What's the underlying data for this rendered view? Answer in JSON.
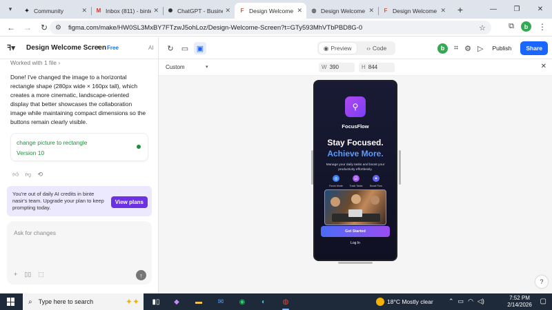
{
  "browser": {
    "tabs": [
      {
        "title": "Community",
        "icon": "community-icon",
        "active": false
      },
      {
        "title": "Inbox (811) - binte",
        "icon": "gmail-icon",
        "active": false
      },
      {
        "title": "ChatGPT - Business",
        "icon": "chatgpt-icon",
        "active": false
      },
      {
        "title": "Design Welcome S",
        "icon": "figma-icon",
        "active": true
      },
      {
        "title": "Design Welcome S",
        "icon": "globe-icon",
        "active": false
      },
      {
        "title": "Design Welcome S",
        "icon": "figma-icon",
        "active": false
      }
    ],
    "url": "figma.com/make/HW0SL3MxBY7FTzwJ5ohLoz/Design-Welcome-Screen?t=GTy593MhVTbPBD8G-0",
    "profile_initial": "b"
  },
  "figma": {
    "file_name": "Design Welcome Screen",
    "plan": "Free",
    "ai_label": "AI",
    "preview_label": "Preview",
    "code_label": "Code",
    "avatar_initial": "b",
    "publish_label": "Publish",
    "share_label": "Share"
  },
  "chat": {
    "worked": "Worked with 1 file",
    "message": "Done! I've changed the image to a horizontal rectangle shape (280px wide × 160px tall), which creates a more cinematic, landscape-oriented display that better showcases the collaboration image while maintaining compact dimensions so the buttons remain clearly visible.",
    "version_title": "change picture to rectangle",
    "version_label": "Version 10",
    "credits_text": "You're out of daily AI credits in binte nasir's team. Upgrade your plan to keep prompting today.",
    "view_plans": "View plans",
    "composer_placeholder": "Ask for changes"
  },
  "canvas": {
    "device": "Custom",
    "width_label": "W",
    "width_value": "390",
    "height_label": "H",
    "height_value": "844"
  },
  "app": {
    "name": "FocusFlow",
    "headline1": "Stay Focused.",
    "headline2": "Achieve More.",
    "tagline": "Manage your daily tasks and boost your productivity effortlessly.",
    "features": [
      {
        "label": "Focus Mode",
        "color": "#3b82f6"
      },
      {
        "label": "Track Tasks",
        "color": "#a855f7"
      },
      {
        "label": "Boost Flow",
        "color": "#6366f1"
      }
    ],
    "cta": "Get Started",
    "login": "Log In"
  },
  "taskbar": {
    "search_placeholder": "Type here to search",
    "weather": "18°C  Mostly clear",
    "time": "7:52 PM",
    "date": "2/14/2026"
  },
  "colors": {
    "accent": "#1a66ff",
    "upgrade": "#6c31e3",
    "success": "#1e8e3e"
  }
}
